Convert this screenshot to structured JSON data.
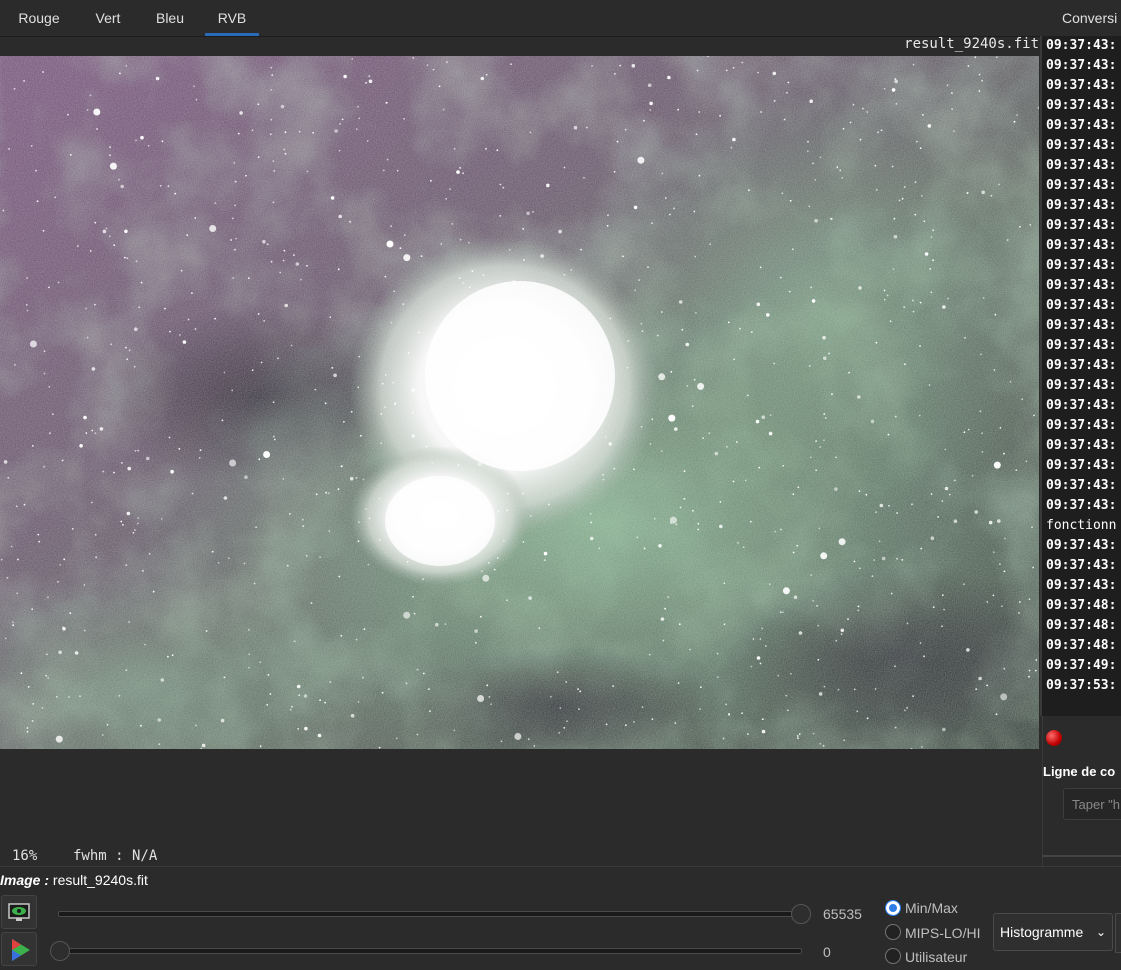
{
  "tabs": {
    "rouge": "Rouge",
    "vert": "Vert",
    "bleu": "Bleu",
    "rvb": "RVB",
    "active": "RVB"
  },
  "right_tab": "Conversi",
  "viewer": {
    "filename": "result_9240s.fit",
    "zoom": "16%",
    "fwhm": "fwhm : N/A"
  },
  "console": {
    "lines": [
      "09:37:43:",
      "09:37:43:",
      "09:37:43:",
      "09:37:43:",
      "09:37:43:",
      "09:37:43:",
      "09:37:43:",
      "09:37:43:",
      "09:37:43:",
      "09:37:43:",
      "09:37:43:",
      "09:37:43:",
      "09:37:43:",
      "09:37:43:",
      "09:37:43:",
      "09:37:43:",
      "09:37:43:",
      "09:37:43:",
      "09:37:43:",
      "09:37:43:",
      "09:37:43:",
      "09:37:43:",
      "09:37:43:",
      "09:37:43:",
      "fonctionn",
      "09:37:43:",
      "09:37:43:",
      "09:37:43:",
      "09:37:48:",
      "09:37:48:",
      "09:37:48:",
      "09:37:49:",
      "09:37:53:"
    ],
    "command_label": "Ligne de co",
    "command_placeholder": "Taper \"h"
  },
  "bottom": {
    "image_label": "Image :",
    "image_name": "result_9240s.fit",
    "slider_high_value": "65535",
    "slider_low_value": "0",
    "radio_minmax": "Min/Max",
    "radio_mips": "MIPS-LO/HI",
    "radio_user": "Utilisateur",
    "selected_radio": "Min/Max",
    "histogram_select": "Histogramme"
  },
  "colors": {
    "accent": "#2a6bb8",
    "background": "#2b2b2b",
    "console_bg": "#1e1e1e",
    "radio_on": "#2e7ee8",
    "stop": "#d00000"
  },
  "icons": {
    "stop": "record-stop-icon",
    "histogram_toggle": "eye-monitor-icon",
    "color_toggle": "color-triangle-icon",
    "chevron": "chevron-down-icon"
  }
}
